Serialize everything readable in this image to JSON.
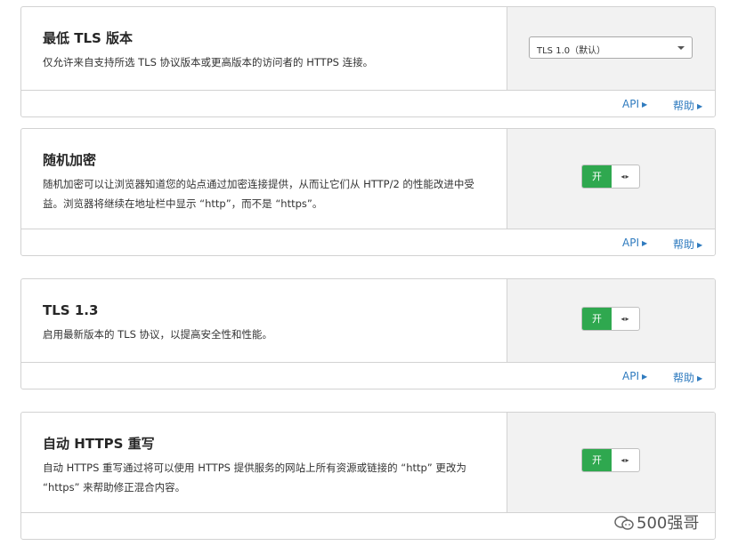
{
  "cards": [
    {
      "title": "最低 TLS 版本",
      "description": "仅允许来自支持所选 TLS 协议版本或更高版本的访问者的 HTTPS 连接。",
      "control": {
        "type": "select",
        "value": "TLS 1.0（默认）"
      },
      "footer": {
        "api": "API",
        "help": "帮助"
      }
    },
    {
      "title": "随机加密",
      "description": "随机加密可以让浏览器知道您的站点通过加密连接提供，从而让它们从 HTTP/2 的性能改进中受益。浏览器将继续在地址栏中显示 “http”，而不是 “https”。",
      "control": {
        "type": "toggle",
        "on_label": "开",
        "handle": "◂▸"
      },
      "footer": {
        "api": "API",
        "help": "帮助"
      }
    },
    {
      "title": "TLS 1.3",
      "description": "启用最新版本的 TLS 协议，以提高安全性和性能。",
      "control": {
        "type": "toggle",
        "on_label": "开",
        "handle": "◂▸"
      },
      "footer": {
        "api": "API",
        "help": "帮助"
      }
    },
    {
      "title": "自动 HTTPS 重写",
      "description": "自动 HTTPS 重写通过将可以使用 HTTPS 提供服务的网站上所有资源或链接的 “http” 更改为 “https” 来帮助修正混合内容。",
      "control": {
        "type": "toggle",
        "on_label": "开",
        "handle": "◂▸"
      },
      "footer": {
        "api": "",
        "help": ""
      }
    }
  ],
  "watermark": "500强哥",
  "colors": {
    "toggle_on": "#2fa84f",
    "link": "#2f7bbf",
    "control_bg": "#f2f2f2",
    "border": "#d2d2d2"
  }
}
